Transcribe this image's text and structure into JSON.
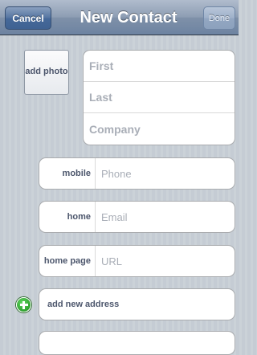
{
  "navbar": {
    "cancel_label": "Cancel",
    "title": "New Contact",
    "done_label": "Done"
  },
  "photo": {
    "label": "add photo"
  },
  "name_group": {
    "placeholders": [
      "First",
      "Last",
      "Company"
    ]
  },
  "fields": [
    {
      "label": "mobile",
      "placeholder": "Phone"
    },
    {
      "label": "home",
      "placeholder": "Email"
    },
    {
      "label": "home page",
      "placeholder": "URL"
    }
  ],
  "address": {
    "label": "add new address"
  }
}
